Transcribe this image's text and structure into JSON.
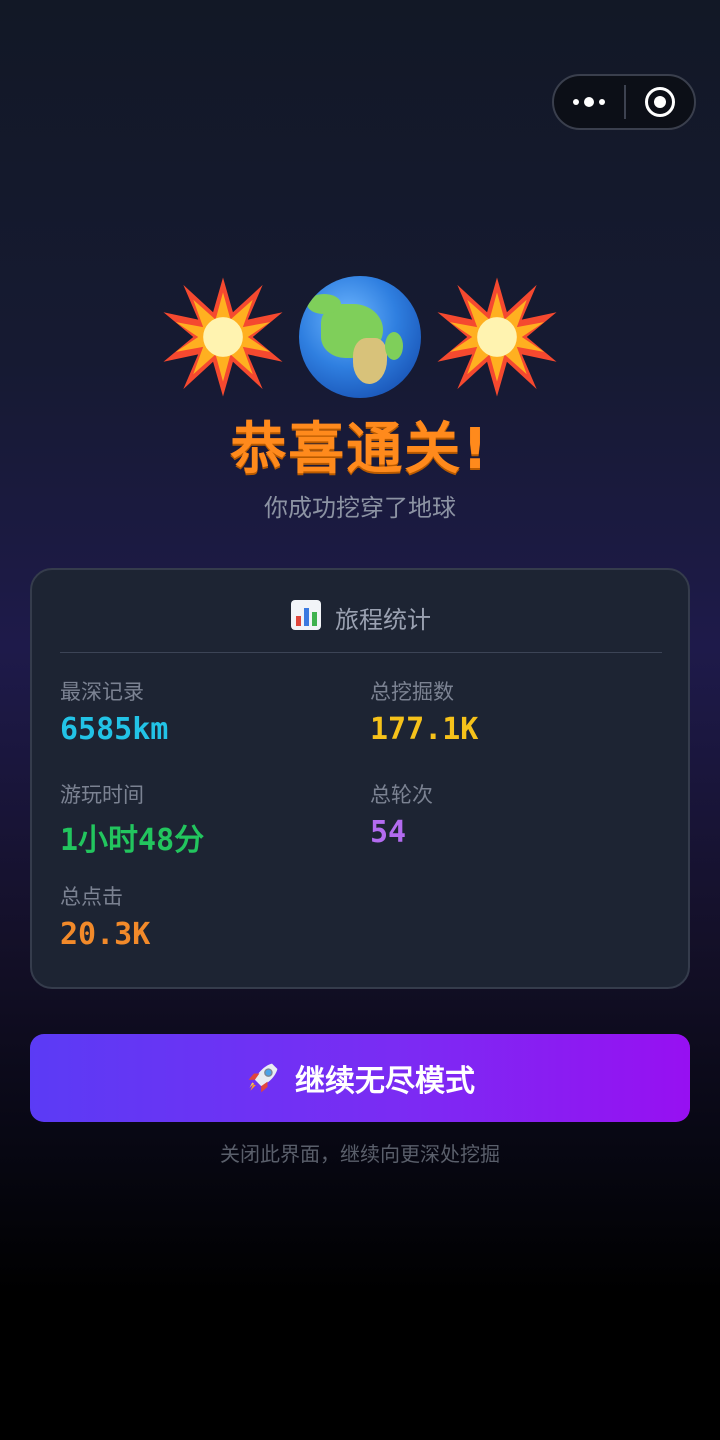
{
  "capsule": {
    "more_icon": "more-dots-icon",
    "close_icon": "close-target-icon"
  },
  "hero": {
    "left_icon": "explosion-icon",
    "center_icon": "earth-globe-icon",
    "right_icon": "explosion-icon",
    "title": "恭喜通关!",
    "subtitle": "你成功挖穿了地球"
  },
  "stats": {
    "header_icon": "bar-chart-icon",
    "header": "旅程统计",
    "items": [
      {
        "label": "最深记录",
        "value": "6585km",
        "color": "#22c3e6"
      },
      {
        "label": "总挖掘数",
        "value": "177.1K",
        "color": "#f6c21a"
      },
      {
        "label": "游玩时间",
        "value": "1小时48分",
        "color": "#22c55e"
      },
      {
        "label": "总轮次",
        "value": "54",
        "color": "#b36bf0"
      },
      {
        "label": "总点击",
        "value": "20.3K",
        "color": "#f28a2a"
      }
    ]
  },
  "cta": {
    "icon": "rocket-icon",
    "label": "继续无尽模式"
  },
  "hint": "关闭此界面，继续向更深处挖掘",
  "colors": {
    "title": "#ff8a1c",
    "card_bg": "#1d2433",
    "button_start": "#5b3bf5",
    "button_end": "#9710f2"
  }
}
